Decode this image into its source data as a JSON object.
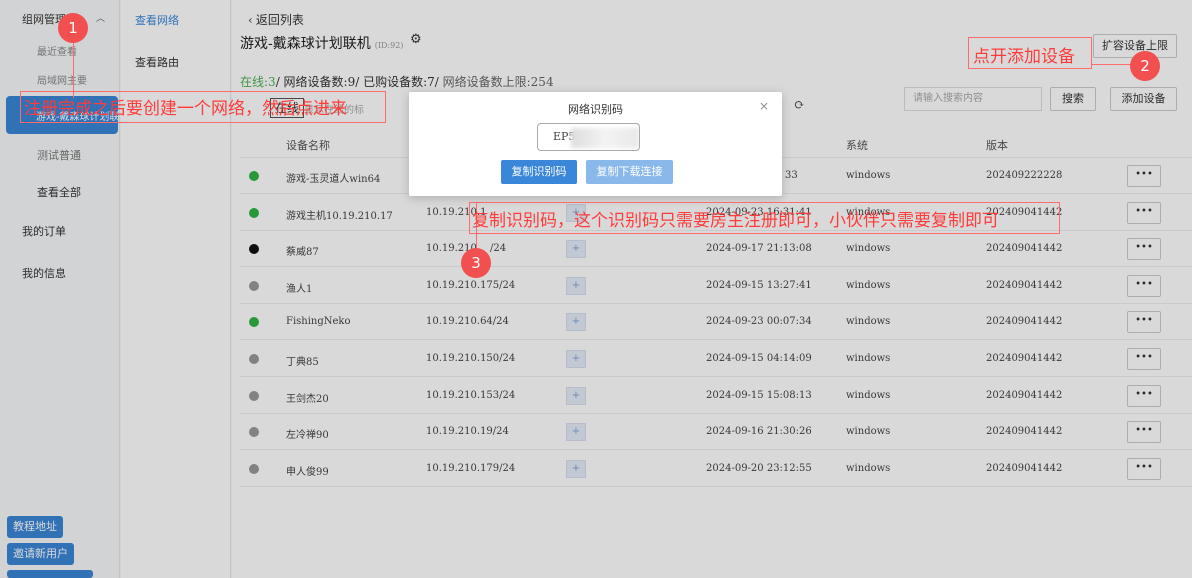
{
  "sidebar": {
    "group_label": "组网管理",
    "sub_recent": "最近查看",
    "sub_lan": "局域网主要",
    "active_item": "游戏-戴森球计划联机",
    "test_item": "测试普通",
    "view_all": "查看全部",
    "orders": "我的订单",
    "my_info": "我的信息",
    "tutorial_btn": "教程地址",
    "invite_btn": "邀请新用户"
  },
  "subnav": {
    "view_network": "查看网络",
    "view_route": "查看路由"
  },
  "header": {
    "back": "返回列表",
    "title": "游戏-戴森球计划联机",
    "id_label": "(ID:92)",
    "expand_btn": "扩容设备上限",
    "add_btn": "添加设备",
    "search_btn": "搜索",
    "search_placeholder": "请输入搜索内容"
  },
  "stats": {
    "online_label": "在线:",
    "online_count": "3",
    "rest": "/ 网络设备数:9/ 已购设备数:7/",
    "limit": " 网络设备数上限:254"
  },
  "filter": {
    "tag": "在线",
    "hint": "显示在线的标"
  },
  "table": {
    "headers": [
      "设备名称",
      "系统",
      "版本"
    ],
    "rows": [
      {
        "status": "online",
        "name": "游戏-玉灵道人win64",
        "ip": "",
        "time": "33",
        "os": "windows",
        "version": "202409222228"
      },
      {
        "status": "online",
        "name": "游戏主机10.19.210.17",
        "ip": "10.19.210.1",
        "time": "2024-09-23 16:31:41",
        "os": "windows",
        "version": "202409041442"
      },
      {
        "status": "black",
        "name": "蔡威87",
        "ip": "10.19.210.",
        "ip_tail": "/24",
        "time": "2024-09-17 21:13:08",
        "os": "windows",
        "version": "202409041442"
      },
      {
        "status": "offline",
        "name": "渔人1",
        "ip": "10.19.210.175/24",
        "time": "2024-09-15 13:27:41",
        "os": "windows",
        "version": "202409041442"
      },
      {
        "status": "online",
        "name": "FishingNeko",
        "ip": "10.19.210.64/24",
        "time": "2024-09-23 00:07:34",
        "os": "windows",
        "version": "202409041442"
      },
      {
        "status": "offline",
        "name": "丁典85",
        "ip": "10.19.210.150/24",
        "time": "2024-09-15 04:14:09",
        "os": "windows",
        "version": "202409041442"
      },
      {
        "status": "offline",
        "name": "王剑杰20",
        "ip": "10.19.210.153/24",
        "time": "2024-09-15 15:08:13",
        "os": "windows",
        "version": "202409041442"
      },
      {
        "status": "offline",
        "name": "左冷禅90",
        "ip": "10.19.210.19/24",
        "time": "2024-09-16 21:30:26",
        "os": "windows",
        "version": "202409041442"
      },
      {
        "status": "offline",
        "name": "申人俊99",
        "ip": "10.19.210.179/24",
        "time": "2024-09-20 23:12:55",
        "os": "windows",
        "version": "202409041442"
      }
    ],
    "plus": "+",
    "more": "•••"
  },
  "modal": {
    "title": "网络识别码",
    "code": "EP5",
    "copy_code_btn": "复制识别码",
    "copy_link_btn": "复制下载连接",
    "close": "×"
  },
  "annotations": {
    "step1_num": "1",
    "step1_text": "注册完成之后要创建一个网络，然后点进来",
    "step2_num": "2",
    "step2_text": "点开添加设备",
    "step3_num": "3",
    "step3_text": "复制识别码，这个识别码只需要房主注册即可，小伙伴只需要复制即可"
  },
  "colors": {
    "primary": "#3a86d8",
    "online": "#2fb344",
    "offline": "#999999",
    "black": "#111111",
    "annotation": "#ff3b3b"
  }
}
